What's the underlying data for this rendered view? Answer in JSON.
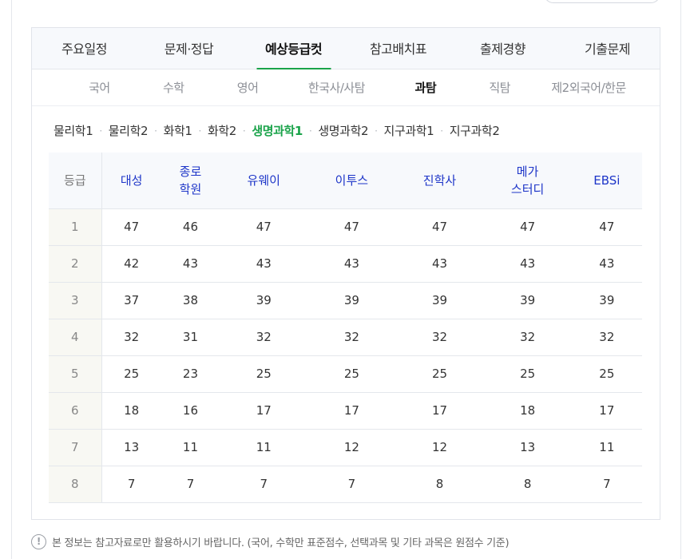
{
  "main_tabs": [
    {
      "label": "주요일정"
    },
    {
      "label": "문제·정답"
    },
    {
      "label": "예상등급컷",
      "active": true
    },
    {
      "label": "참고배치표"
    },
    {
      "label": "출제경향"
    },
    {
      "label": "기출문제"
    }
  ],
  "sub_tabs": [
    {
      "label": "국어"
    },
    {
      "label": "수학"
    },
    {
      "label": "영어"
    },
    {
      "label": "한국사/사탐"
    },
    {
      "label": "과탐",
      "active": true
    },
    {
      "label": "직탐"
    },
    {
      "label": "제2외국어/한문"
    }
  ],
  "subjects": [
    {
      "label": "물리학1"
    },
    {
      "label": "물리학2"
    },
    {
      "label": "화학1"
    },
    {
      "label": "화학2"
    },
    {
      "label": "생명과학1",
      "active": true
    },
    {
      "label": "생명과학2"
    },
    {
      "label": "지구과학1"
    },
    {
      "label": "지구과학2"
    }
  ],
  "table": {
    "grade_header": "등급",
    "columns": [
      "대성",
      "종로\n학원",
      "유웨이",
      "이투스",
      "진학사",
      "메가\n스터디",
      "EBSi"
    ],
    "rows": [
      {
        "grade": "1",
        "values": [
          "47",
          "46",
          "47",
          "47",
          "47",
          "47",
          "47"
        ]
      },
      {
        "grade": "2",
        "values": [
          "42",
          "43",
          "43",
          "43",
          "43",
          "43",
          "43"
        ]
      },
      {
        "grade": "3",
        "values": [
          "37",
          "38",
          "39",
          "39",
          "39",
          "39",
          "39"
        ]
      },
      {
        "grade": "4",
        "values": [
          "32",
          "31",
          "32",
          "32",
          "32",
          "32",
          "32"
        ]
      },
      {
        "grade": "5",
        "values": [
          "25",
          "23",
          "25",
          "25",
          "25",
          "25",
          "25"
        ]
      },
      {
        "grade": "6",
        "values": [
          "18",
          "16",
          "17",
          "17",
          "17",
          "18",
          "17"
        ]
      },
      {
        "grade": "7",
        "values": [
          "13",
          "11",
          "11",
          "12",
          "12",
          "13",
          "11"
        ]
      },
      {
        "grade": "8",
        "values": [
          "7",
          "7",
          "7",
          "7",
          "8",
          "8",
          "7"
        ]
      }
    ]
  },
  "notice": {
    "icon": "exclamation-icon",
    "glyph": "!",
    "text": "본 정보는 참고자료로만 활용하시기 바랍니다. (국어, 수학만 표준점수, 선택과목 및 기타 과목은 원점수 기준)"
  },
  "colors": {
    "accent_green": "#1aa34a",
    "header_blue": "#1d35c8"
  }
}
